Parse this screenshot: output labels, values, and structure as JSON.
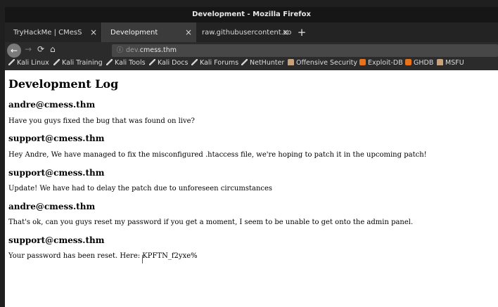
{
  "window": {
    "title": "Development - Mozilla Firefox"
  },
  "tabs": [
    {
      "label": "TryHackMe | CMesS",
      "close": "×"
    },
    {
      "label": "Development",
      "close": "×"
    },
    {
      "label": "raw.githubusercontent.co",
      "close": "×"
    }
  ],
  "new_tab": "+",
  "nav": {
    "back": "←",
    "forward": "→",
    "reload": "⟳",
    "home": "⌂",
    "info": "ⓘ",
    "url_prefix": "dev.",
    "url_host": "cmess.thm"
  },
  "bookmarks": [
    {
      "label": "Kali Linux",
      "icon": "kali-dragon-icon"
    },
    {
      "label": "Kali Training",
      "icon": "kali-dragon-icon"
    },
    {
      "label": "Kali Tools",
      "icon": "kali-dragon-icon"
    },
    {
      "label": "Kali Docs",
      "icon": "kali-dragon-icon"
    },
    {
      "label": "Kali Forums",
      "icon": "kali-dragon-icon"
    },
    {
      "label": "NetHunter",
      "icon": "kali-dragon-icon"
    },
    {
      "label": "Offensive Security",
      "icon": "offsec-icon"
    },
    {
      "label": "Exploit-DB",
      "icon": "exploitdb-icon"
    },
    {
      "label": "GHDB",
      "icon": "ghdb-icon"
    },
    {
      "label": "MSFU",
      "icon": "msfu-icon"
    }
  ],
  "page": {
    "heading": "Development Log",
    "entries": [
      {
        "user": "andre@cmess.thm",
        "message": "Have you guys fixed the bug that was found on live?"
      },
      {
        "user": "support@cmess.thm",
        "message": "Hey Andre, We have managed to fix the misconfigured .htaccess file, we're hoping to patch it in the upcoming patch!"
      },
      {
        "user": "support@cmess.thm",
        "message": "Update! We have had to delay the patch due to unforeseen circumstances"
      },
      {
        "user": "andre@cmess.thm",
        "message": "That's ok, can you guys reset my password if you get a moment, I seem to be unable to get onto the admin panel."
      },
      {
        "user": "support@cmess.thm",
        "message": "Your password has been reset. Here: KPFTN_f2yxe%"
      }
    ]
  }
}
